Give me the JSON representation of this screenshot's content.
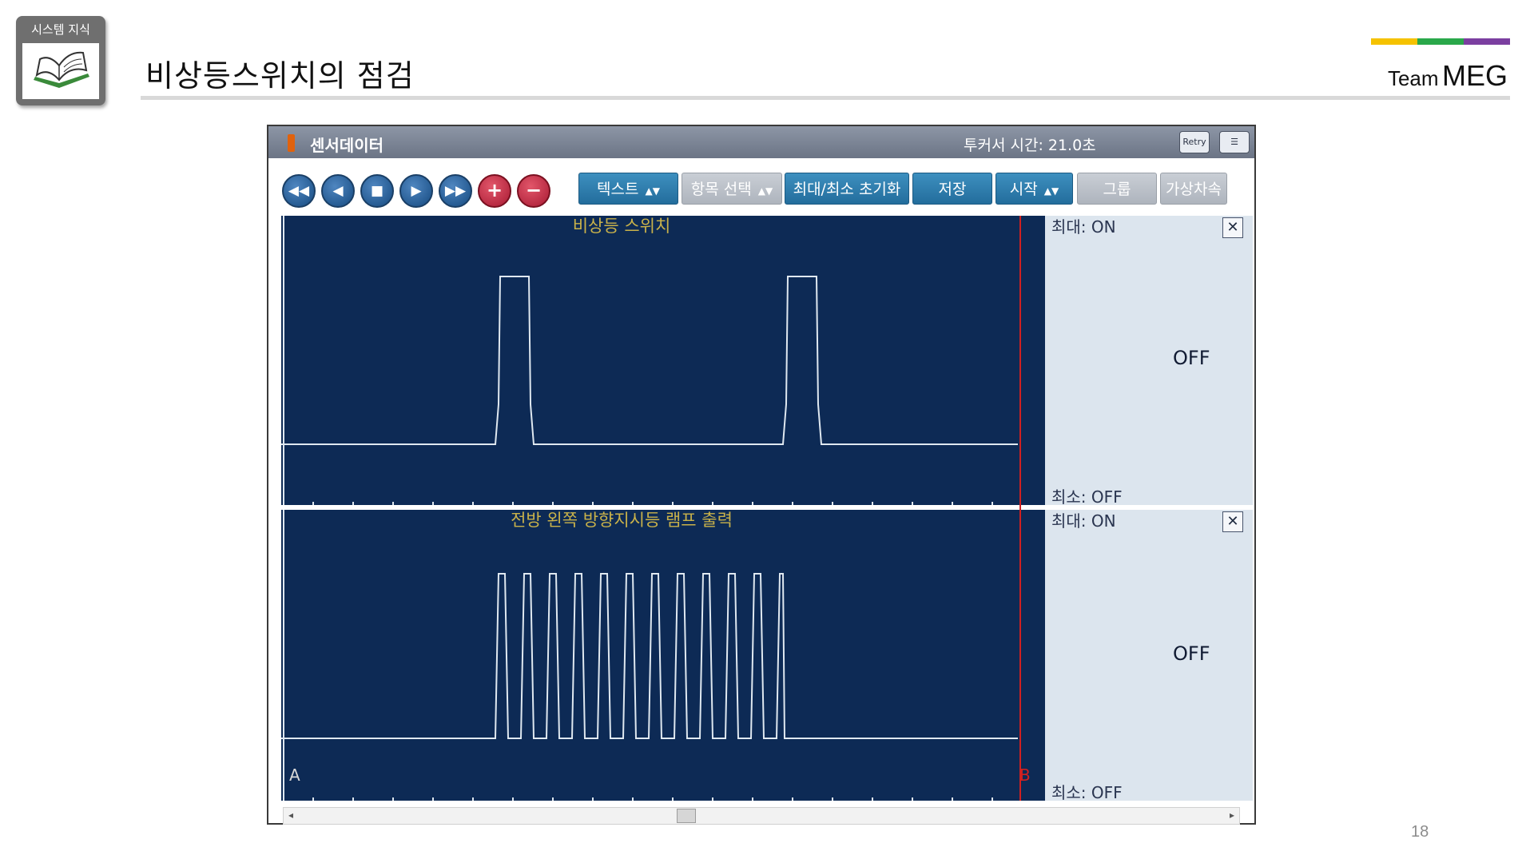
{
  "slide": {
    "badge_label": "시스템 지식",
    "title": "비상등스위치의 점검",
    "team_prefix": "Team",
    "team_name": "MEG",
    "page_number": "18",
    "accent_colors": [
      "#f5c200",
      "#2aa84a",
      "#7b3fa0"
    ]
  },
  "window": {
    "title": "센서데이터",
    "cursor_time": "투커서 시간: 21.0초",
    "retry_label": "Retry"
  },
  "toolbar": {
    "nav_icons": [
      "rewind-icon",
      "step-back-icon",
      "stop-icon",
      "play-icon",
      "fast-forward-icon",
      "zoom-in-icon",
      "zoom-out-icon"
    ],
    "text_button": "텍스트",
    "item_select_button": "항목 선택",
    "minmax_reset_button": "최대/최소 초기화",
    "save_button": "저장",
    "start_button": "시작",
    "group_button": "그룹",
    "virtual_vehicle_button": "가상차속"
  },
  "panels": [
    {
      "title": "비상등 스위치",
      "max_label": "최대: ON",
      "min_label": "최소: OFF",
      "current_state": "OFF"
    },
    {
      "title": "전방 왼쪽 방향지시등 램프 출력",
      "max_label": "최대: ON",
      "min_label": "최소: OFF",
      "current_state": "OFF"
    }
  ],
  "cursor_markers": {
    "a": "A",
    "b": "B"
  },
  "colors": {
    "plot_bg": "#0d2a55",
    "trace": "#dfe8f0",
    "panel_title": "#c9b24a",
    "side_bg": "#dce5ee",
    "cursor": "#d02020"
  }
}
